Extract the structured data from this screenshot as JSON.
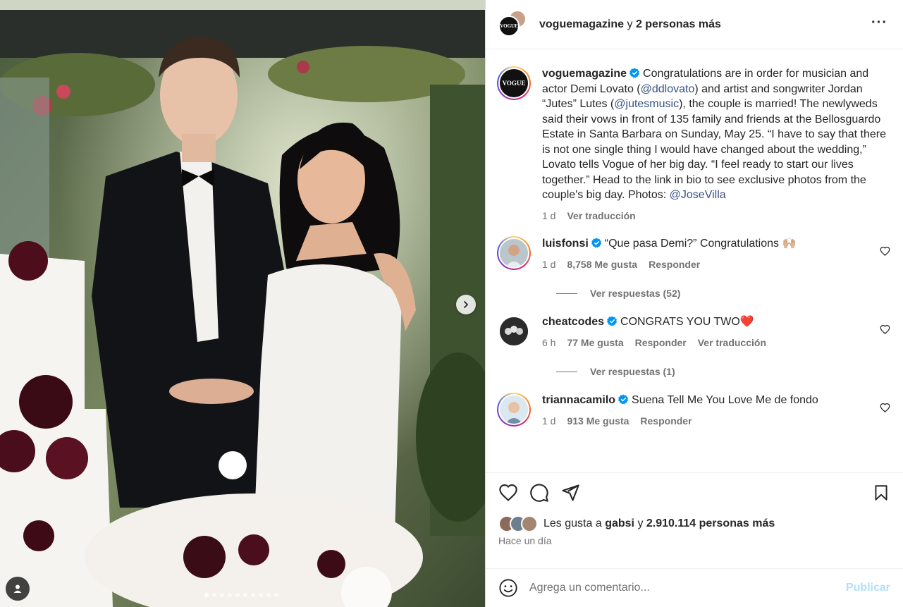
{
  "header": {
    "username": "voguemagazine",
    "connector": "y",
    "others": "2 personas más",
    "more_icon": "more-horizontal-icon"
  },
  "caption": {
    "username": "voguemagazine",
    "verified": true,
    "text_1": "Congratulations are in order for musician and actor Demi Lovato (",
    "mention_1": "@ddlovato",
    "text_2": ") and artist and songwriter Jordan “Jutes” Lutes (",
    "mention_2": "@jutesmusic",
    "text_3": "), the couple is married! The newlyweds said their vows in front of 135 family and friends at the Bellosguardo Estate in Santa Barbara on Sunday, May 25. “I have to say that there is not one single thing I would have changed about the wedding,” Lovato tells Vogue of her big day. “I feel ready to start our lives together.” Head to the link in bio to see exclusive photos from the couple's big day. Photos: ",
    "mention_3": "@JoseVilla",
    "time": "1 d",
    "translate": "Ver traducción"
  },
  "comments": [
    {
      "username": "luisfonsi",
      "text": "“Que pasa Demi?” Congratulations 🙌🏼",
      "time": "1 d",
      "likes": "8,758 Me gusta",
      "reply": "Responder",
      "view_replies": "Ver respuestas (52)"
    },
    {
      "username": "cheatcodes",
      "text": "CONGRATS YOU TWO❤️",
      "time": "6 h",
      "likes": "77 Me gusta",
      "reply": "Responder",
      "translate": "Ver traducción",
      "view_replies": "Ver respuestas (1)"
    },
    {
      "username": "triannacamilo",
      "text": "Suena Tell Me You Love Me de fondo",
      "time": "1 d",
      "likes": "913 Me gusta",
      "reply": "Responder"
    }
  ],
  "likes": {
    "prefix": "Les gusta a",
    "user": "gabsi",
    "connector": "y",
    "count": "2.910.114 personas más"
  },
  "post_time": "Hace un día",
  "add_comment": {
    "placeholder": "Agrega un comentario...",
    "publish_label": "Publicar"
  },
  "carousel": {
    "total": 10,
    "active": 1
  },
  "colors": {
    "accent": "#0095f6",
    "verified": "#0095f6",
    "mention": "#385185",
    "muted": "#737373",
    "publish_disabled": "#b2dffc"
  }
}
